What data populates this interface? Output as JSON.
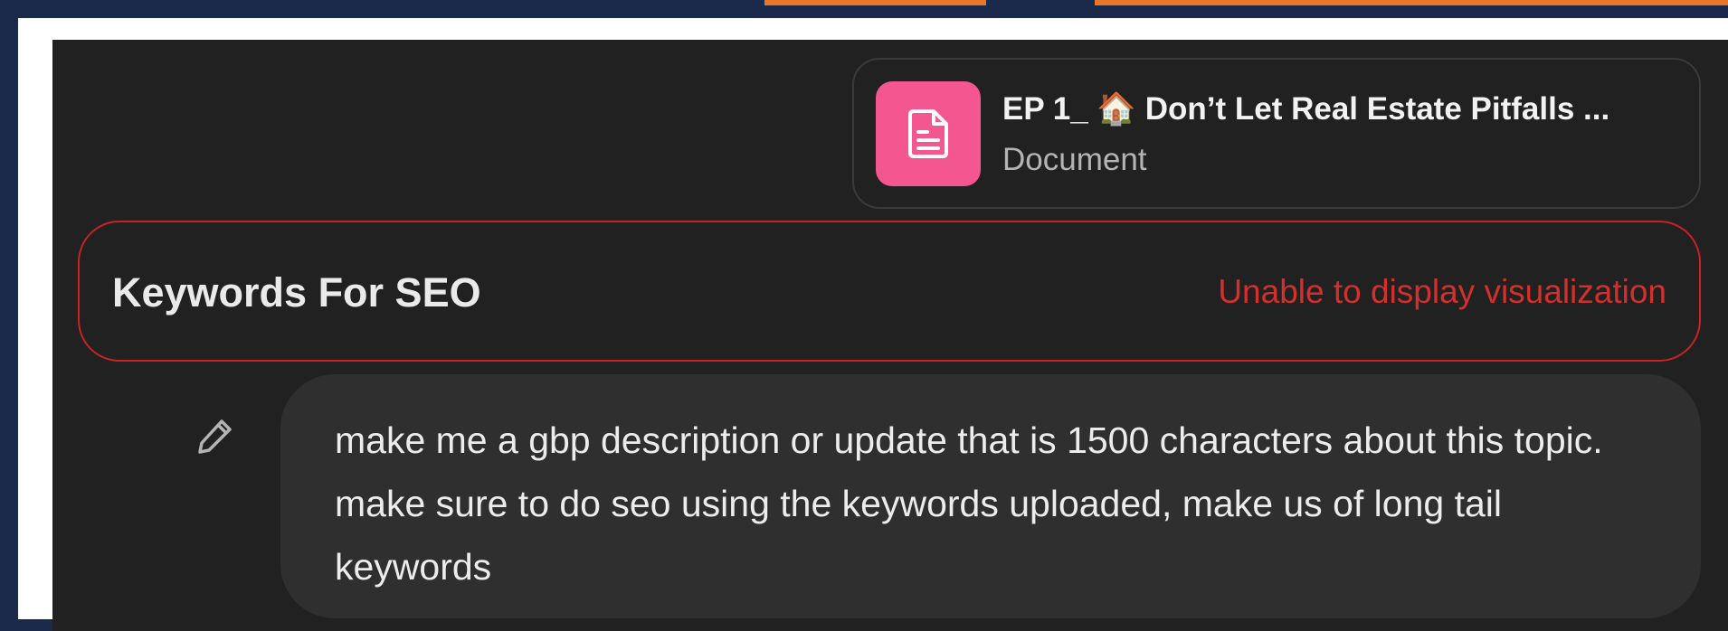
{
  "attachment": {
    "title": "EP 1_ 🏠 Don’t Let Real Estate Pitfalls ...",
    "type": "Document",
    "icon": "document-icon",
    "tile_color": "#f4568f"
  },
  "visualization": {
    "title": "Keywords For SEO",
    "error_message": "Unable to display visualization",
    "error_color": "#c62424"
  },
  "message": {
    "edit_icon": "pencil-icon",
    "text": "make me a gbp description or update that is 1500 characters about this topic. make sure to do seo using the keywords uploaded, make us of long tail keywords"
  }
}
